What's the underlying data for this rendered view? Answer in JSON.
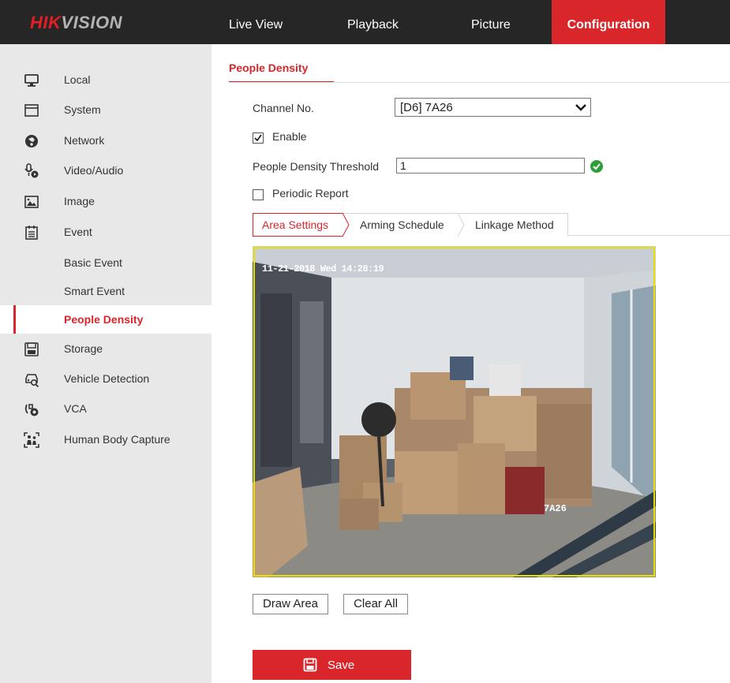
{
  "brand": {
    "logo_hik": "HIK",
    "logo_vision": "VISION"
  },
  "nav": {
    "tabs": [
      {
        "label": "Live View"
      },
      {
        "label": "Playback"
      },
      {
        "label": "Picture"
      },
      {
        "label": "Configuration",
        "active": true
      }
    ]
  },
  "sidebar": {
    "items": [
      {
        "label": "Local",
        "icon": "monitor-icon"
      },
      {
        "label": "System",
        "icon": "system-icon"
      },
      {
        "label": "Network",
        "icon": "network-icon"
      },
      {
        "label": "Video/Audio",
        "icon": "video-audio-icon"
      },
      {
        "label": "Image",
        "icon": "image-icon"
      },
      {
        "label": "Event",
        "icon": "event-icon"
      },
      {
        "label": "Storage",
        "icon": "storage-icon"
      },
      {
        "label": "Vehicle Detection",
        "icon": "vehicle-detection-icon"
      },
      {
        "label": "VCA",
        "icon": "vca-icon"
      },
      {
        "label": "Human Body Capture",
        "icon": "human-body-capture-icon"
      }
    ],
    "event_sub": [
      {
        "label": "Basic Event"
      },
      {
        "label": "Smart Event"
      },
      {
        "label": "People Density",
        "active": true
      }
    ]
  },
  "page": {
    "title": "People Density",
    "channel_label": "Channel No.",
    "channel_value": "[D6] 7A26",
    "enable_label": "Enable",
    "enable_checked": true,
    "threshold_label": "People Density Threshold",
    "threshold_value": "1",
    "periodic_label": "Periodic Report",
    "periodic_checked": false,
    "subtabs": [
      {
        "label": "Area Settings",
        "active": true
      },
      {
        "label": "Arming Schedule"
      },
      {
        "label": "Linkage Method"
      }
    ],
    "video": {
      "osd_date": "11-21-2018 Wed",
      "osd_time": "14:28:19",
      "osd_name": "7A26"
    },
    "draw_area_label": "Draw Area",
    "clear_all_label": "Clear All",
    "save_label": "Save"
  },
  "colors": {
    "accent": "#d8262b",
    "topbar": "#262626",
    "sidebar": "#e8e8e8",
    "area_outline": "#e8e000",
    "valid": "#2e9e3a"
  }
}
